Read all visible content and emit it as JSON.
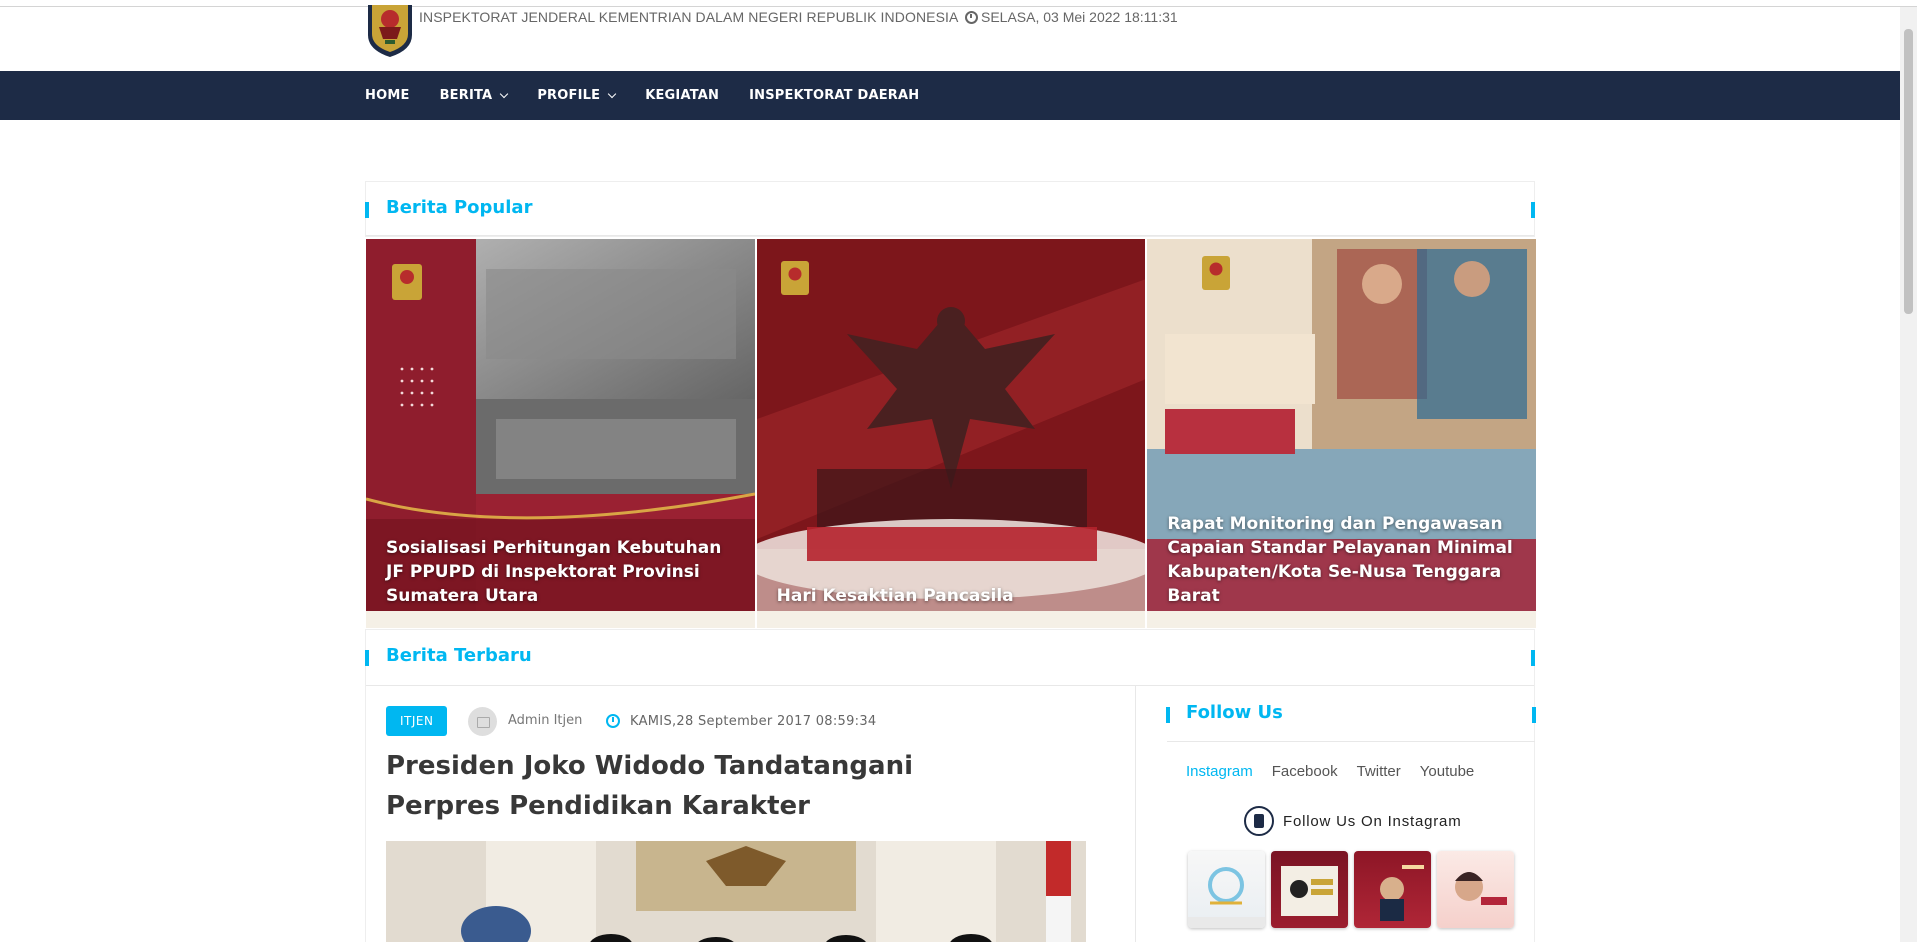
{
  "header": {
    "site_name": "INSPEKTORAT JENDERAL KEMENTRIAN DALAM NEGERI REPUBLIK INDONESIA",
    "datetime": "SELASA, 03 Mei 2022 18:11:31"
  },
  "nav": {
    "items": [
      {
        "label": "HOME",
        "dropdown": false
      },
      {
        "label": "BERITA",
        "dropdown": true
      },
      {
        "label": "PROFILE",
        "dropdown": true
      },
      {
        "label": "KEGIATAN",
        "dropdown": false
      },
      {
        "label": "INSPEKTORAT DAERAH",
        "dropdown": false
      }
    ]
  },
  "popular": {
    "title": "Berita Popular",
    "cards": [
      {
        "caption": "Sosialisasi Perhitungan Kebutuhan JF PPUPD di Inspektorat Provinsi Sumatera Utara"
      },
      {
        "caption": "Hari Kesaktian Pancasila"
      },
      {
        "caption": "Rapat Monitoring dan Pengawasan Capaian Standar Pelayanan Minimal Kabupaten/Kota Se-Nusa Tenggara Barat"
      }
    ]
  },
  "latest": {
    "title": "Berita Terbaru",
    "post": {
      "tag": "ITJEN",
      "author": "Admin Itjen",
      "date": "KAMIS,28 September 2017 08:59:34",
      "title": "Presiden Joko Widodo Tandatangani Perpres Pendidikan Karakter"
    }
  },
  "follow": {
    "title": "Follow Us",
    "tabs": [
      "Instagram",
      "Facebook",
      "Twitter",
      "Youtube"
    ],
    "active_tab": "Instagram",
    "instagram_heading": "Follow Us On Instagram"
  },
  "colors": {
    "navbar": "#1d2b46",
    "accent": "#00b7f1"
  }
}
